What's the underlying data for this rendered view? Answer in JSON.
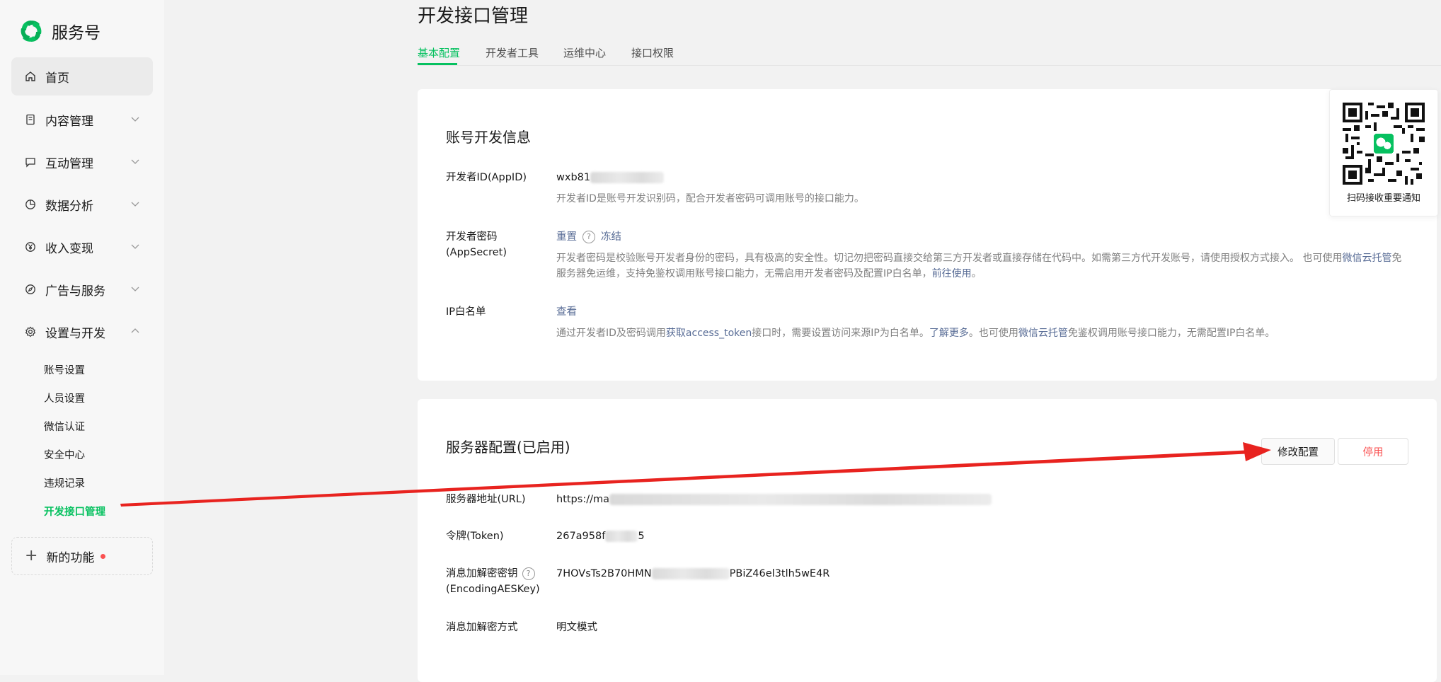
{
  "sidebar": {
    "brand": "服务号",
    "items": [
      {
        "label": "首页"
      },
      {
        "label": "内容管理"
      },
      {
        "label": "互动管理"
      },
      {
        "label": "数据分析"
      },
      {
        "label": "收入变现"
      },
      {
        "label": "广告与服务"
      },
      {
        "label": "设置与开发"
      }
    ],
    "sub_items": [
      {
        "label": "账号设置"
      },
      {
        "label": "人员设置"
      },
      {
        "label": "微信认证"
      },
      {
        "label": "安全中心"
      },
      {
        "label": "违规记录"
      },
      {
        "label": "开发接口管理"
      }
    ],
    "new_feature": "新的功能"
  },
  "main": {
    "title": "开发接口管理",
    "tabs": [
      {
        "label": "基本配置"
      },
      {
        "label": "开发者工具"
      },
      {
        "label": "运维中心"
      },
      {
        "label": "接口权限"
      }
    ],
    "account_card": {
      "title": "账号开发信息",
      "appid": {
        "label": "开发者ID(AppID)",
        "value": "wxb81",
        "desc": "开发者ID是账号开发识别码，配合开发者密码可调用账号的接口能力。"
      },
      "secret": {
        "label": "开发者密码(AppSecret)",
        "reset": "重置",
        "help": "?",
        "freeze": "冻结",
        "desc_1": "开发者密码是校验账号开发者身份的密码，具有极高的安全性。切记勿把密码直接交给第三方开发者或直接存储在代码中。如需第三方代开发账号，请使用授权方式接入。 也可使用",
        "desc_link_1": "微信云托管",
        "desc_2": "免服务器免运维，支持免鉴权调用账号接口能力，无需启用开发者密码及配置IP白名单，",
        "desc_link_2": "前往使用",
        "desc_3": "。"
      },
      "ip": {
        "label": "IP白名单",
        "view": "查看",
        "desc_1": "通过开发者ID及密码调用",
        "desc_link_1": "获取access_token",
        "desc_2": "接口时，需要设置访问来源IP为白名单。",
        "desc_link_2": "了解更多",
        "desc_3": "。也可使用",
        "desc_link_3": "微信云托管",
        "desc_4": "免鉴权调用账号接口能力，无需配置IP白名单。"
      }
    },
    "server_card": {
      "title": "服务器配置(已启用)",
      "edit_btn": "修改配置",
      "stop_btn": "停用",
      "url": {
        "label": "服务器地址(URL)",
        "value": "https://ma"
      },
      "token": {
        "label": "令牌(Token)",
        "value_start": "267a958f",
        "value_end": "5"
      },
      "aes": {
        "label_1": "消息加解密密钥",
        "label_2": "(EncodingAESKey)",
        "help": "?",
        "value_start": "7HOVsTs2B70HMN",
        "value_end": "PBiZ46el3tlh5wE4R"
      },
      "mode": {
        "label": "消息加解密方式",
        "value": "明文模式"
      }
    },
    "qr": {
      "caption": "扫码接收重要通知"
    }
  },
  "colors": {
    "accent": "#07c160",
    "link": "#576b95",
    "danger": "#fa5151",
    "annotation_arrow": "#e8231f"
  }
}
